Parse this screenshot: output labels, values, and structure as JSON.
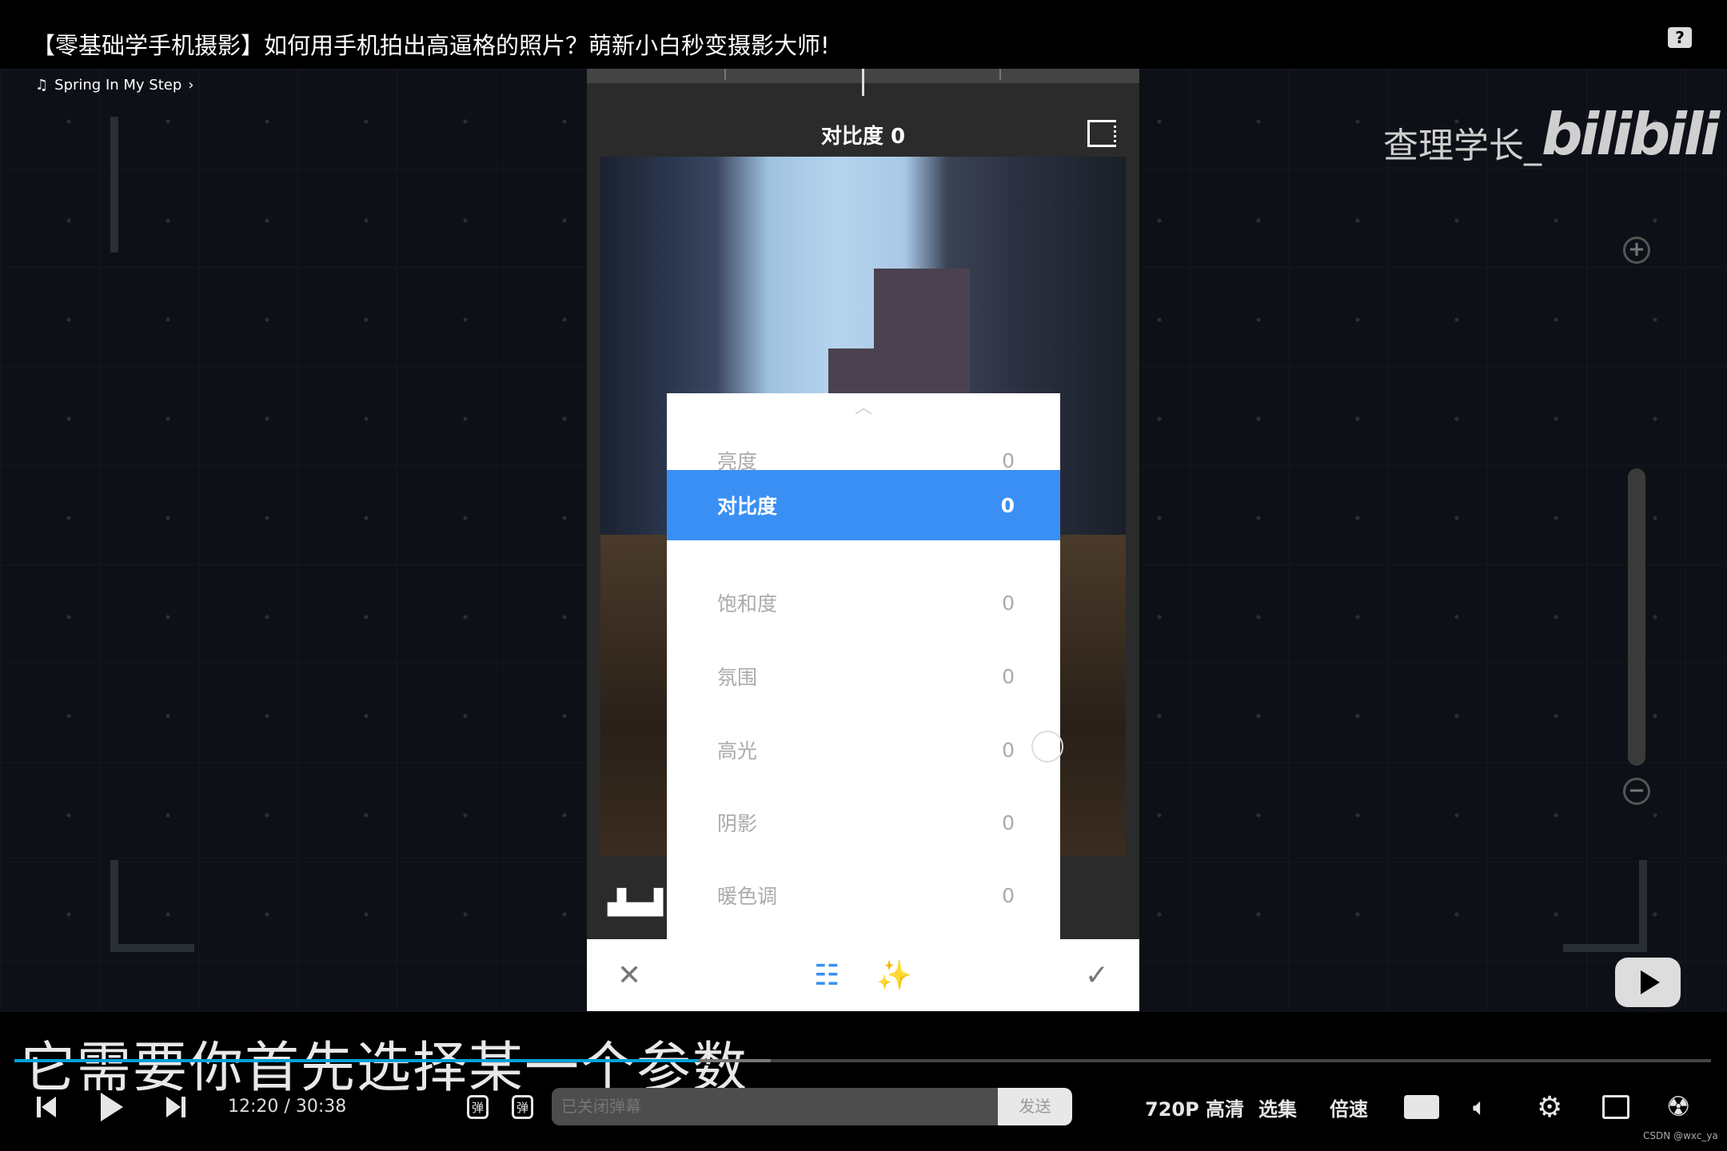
{
  "window": {
    "title": "【零基础学手机摄影】如何用手机拍出高逼格的照片？萌新小白秒变摄影大师!",
    "help_icon": "help-icon"
  },
  "video": {
    "music": {
      "icon": "music-note-icon",
      "label": "Spring In My Step",
      "chevron": "›"
    },
    "watermark": {
      "channel": "查理学长_",
      "brand": "bilibili"
    },
    "zoom": {
      "plus": "+",
      "minus": "−"
    },
    "phone": {
      "header": "对比度 0",
      "menu_rows": [
        {
          "label": "亮度",
          "value": "0"
        },
        {
          "label": "对比度",
          "value": "0",
          "selected": true
        },
        {
          "label": "饱和度",
          "value": "0"
        },
        {
          "label": "氛围",
          "value": "0"
        },
        {
          "label": "高光",
          "value": "0"
        },
        {
          "label": "阴影",
          "value": "0"
        },
        {
          "label": "暖色调",
          "value": "0"
        }
      ],
      "accent": "#3a8ff5",
      "toolbar": {
        "cancel": "✕",
        "adjust": "☷",
        "auto": "✨",
        "confirm": "✓"
      }
    },
    "subtitle": "它需要你首先选择某一个参数"
  },
  "player": {
    "progress_percent": 40.3,
    "buffered_percent": 44.6,
    "progress_color": "#00a1d6",
    "current_time": "12:20",
    "separator": "/",
    "duration": "30:38",
    "danmaku_input_placeholder": "已关闭弹幕",
    "send_label": "发送",
    "quality": "720P 高清",
    "episodes": "选集",
    "speed": "倍速",
    "danmaku_icon_text": "弹"
  },
  "footer_watermark": "CSDN @wxc_ya"
}
